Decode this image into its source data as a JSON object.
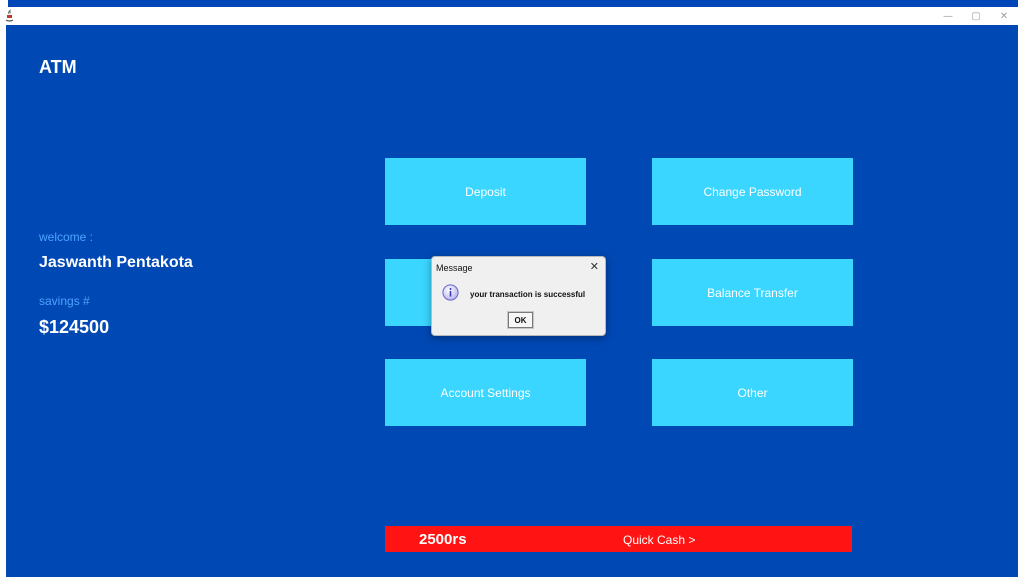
{
  "window": {
    "minimize_glyph": "—",
    "restore_glyph": "▢",
    "close_glyph": "✕",
    "icon": "java-icon"
  },
  "app": {
    "title": "ATM",
    "welcome_label": "welcome :",
    "user_name": "Jaswanth Pentakota",
    "savings_label": "savings #",
    "balance": "$124500"
  },
  "tiles": {
    "deposit": "Deposit",
    "change_password": "Change Password",
    "withdraw": "",
    "balance_transfer": "Balance Transfer",
    "account_settings": "Account Settings",
    "other": "Other"
  },
  "quick_cash": {
    "amount": "2500rs",
    "label": "Quick Cash  >"
  },
  "dialog": {
    "title": "Message",
    "close_glyph": "✕",
    "message": "your transaction is successful",
    "ok_label": "OK",
    "icon": "info-icon"
  },
  "colors": {
    "background": "#0048b4",
    "tile": "#3ad6ff",
    "quick_bar": "#ff1313",
    "label_blue": "#4ea3ff"
  }
}
